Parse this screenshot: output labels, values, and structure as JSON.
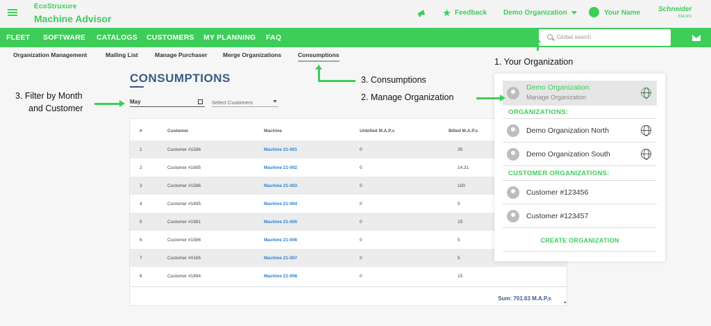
{
  "header": {
    "brand_top": "EcoStruxure",
    "brand_main": "Machine Advisor",
    "feedback": "Feedback",
    "organization": "Demo Organization",
    "user": "Your Name",
    "logo_line1": "Schneider",
    "logo_line2": "Electric"
  },
  "nav": {
    "items": [
      "FLEET",
      "SOFTWARE",
      "CATALOGS",
      "CUSTOMERS",
      "MY PLANNING",
      "FAQ"
    ],
    "search_placeholder": "Global search"
  },
  "subnav": {
    "items": [
      "Organization Management",
      "Mailing List",
      "Manage Purchaser",
      "Merge Organizations",
      "Consumptions"
    ]
  },
  "page": {
    "title": "CONSUMPTIONS",
    "month": "May",
    "customer_placeholder": "Select Customers"
  },
  "table": {
    "headers": [
      "#",
      "Customer",
      "Machine",
      "Unbilled M.A.P.s",
      "Billed M.A.P.s"
    ],
    "rows": [
      [
        "1",
        "Customer #1586",
        "Machine 21-001",
        "0",
        "35"
      ],
      [
        "2",
        "Customer #1695",
        "Machine 21-002",
        "0",
        "14.31"
      ],
      [
        "3",
        "Customer #1586",
        "Machine 21-003",
        "0",
        "100"
      ],
      [
        "4",
        "Customer #1895",
        "Machine 21-004",
        "0",
        "5"
      ],
      [
        "5",
        "Customer #1981",
        "Machine 21-005",
        "0",
        "15"
      ],
      [
        "6",
        "Customer #1586",
        "Machine 21-006",
        "0",
        "5"
      ],
      [
        "7",
        "Customer #0165",
        "Machine 21-007",
        "0",
        "5"
      ],
      [
        "8",
        "Customer #1894",
        "Machine 21-008",
        "0",
        "15"
      ]
    ],
    "sum": "Sum: 701.63 M.A.P.s"
  },
  "panel": {
    "current_org": "Demo Organization",
    "manage": "Manage Organization",
    "organizations_header": "ORGANIZATIONS:",
    "organizations": [
      "Demo Organization North",
      "Demo Organization South"
    ],
    "customer_orgs_header": "CUSTOMER ORGANIZATIONS:",
    "customer_orgs": [
      "Customer #123456",
      "Customer #123457"
    ],
    "create": "CREATE ORGANIZATION"
  },
  "annotations": {
    "your_org": "1. Your Organization",
    "consumptions": "3.  Consumptions",
    "manage_org": "2. Manage Organization",
    "filter_line1": "3. Filter by Month",
    "filter_line2": "and Customer"
  },
  "colors": {
    "accent": "#3dcd58",
    "title": "#3a5a86",
    "link": "#2a7fd0"
  }
}
